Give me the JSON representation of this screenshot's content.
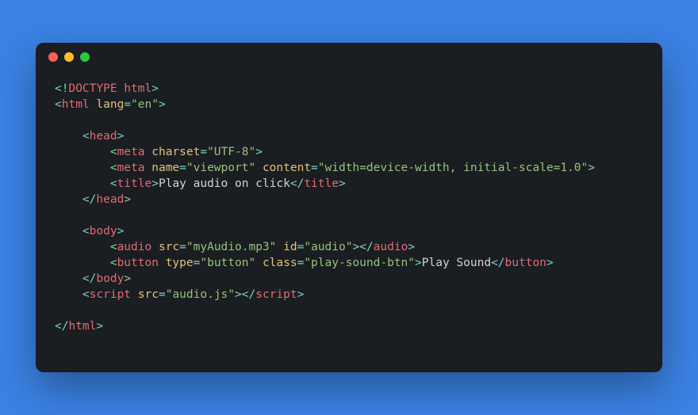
{
  "code": {
    "l1": {
      "doctype_open": "<!",
      "doctype": "DOCTYPE html",
      "doctype_close": ">"
    },
    "l2": {
      "open": "<",
      "tag": "html",
      "sp": " ",
      "attr": "lang",
      "eq": "=",
      "val": "\"en\"",
      "close": ">"
    },
    "l4": {
      "open": "<",
      "tag": "head",
      "close": ">"
    },
    "l5": {
      "open": "<",
      "tag": "meta",
      "sp": " ",
      "attr": "charset",
      "eq": "=",
      "val": "\"UTF-8\"",
      "close": ">"
    },
    "l6": {
      "open": "<",
      "tag": "meta",
      "sp1": " ",
      "attr1": "name",
      "eq1": "=",
      "val1": "\"viewport\"",
      "sp2": " ",
      "attr2": "content",
      "eq2": "=",
      "val2": "\"width=device-width, initial-scale=1.0\"",
      "close": ">"
    },
    "l7": {
      "open": "<",
      "tag": "title",
      "close": ">",
      "text": "Play audio on click",
      "open2": "</",
      "tag2": "title",
      "close2": ">"
    },
    "l8": {
      "open": "</",
      "tag": "head",
      "close": ">"
    },
    "l10": {
      "open": "<",
      "tag": "body",
      "close": ">"
    },
    "l11": {
      "open": "<",
      "tag": "audio",
      "sp1": " ",
      "attr1": "src",
      "eq1": "=",
      "val1": "\"myAudio.mp3\"",
      "sp2": " ",
      "attr2": "id",
      "eq2": "=",
      "val2": "\"audio\"",
      "close": ">",
      "open2": "</",
      "tag2": "audio",
      "close2": ">"
    },
    "l12": {
      "open": "<",
      "tag": "button",
      "sp1": " ",
      "attr1": "type",
      "eq1": "=",
      "val1": "\"button\"",
      "sp2": " ",
      "attr2": "class",
      "eq2": "=",
      "val2": "\"play-sound-btn\"",
      "close": ">",
      "text": "Play Sound",
      "open2": "</",
      "tag2": "button",
      "close2": ">"
    },
    "l13": {
      "open": "</",
      "tag": "body",
      "close": ">"
    },
    "l14": {
      "open": "<",
      "tag": "script",
      "sp": " ",
      "attr": "src",
      "eq": "=",
      "val": "\"audio.js\"",
      "close": ">",
      "open2": "</",
      "tag2": "script",
      "close2": ">"
    },
    "l16": {
      "open": "</",
      "tag": "html",
      "close": ">"
    }
  }
}
